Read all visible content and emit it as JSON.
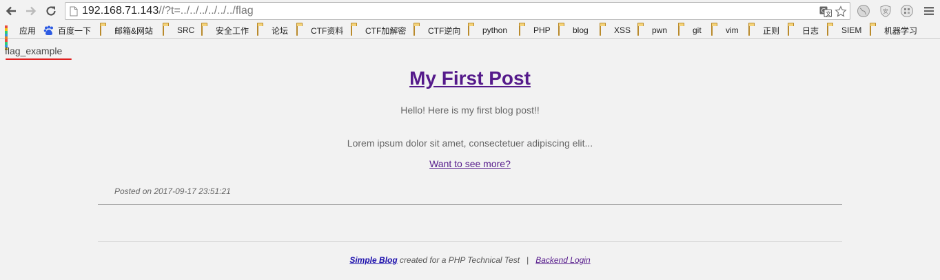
{
  "browser": {
    "url_host": "192.168.71.143",
    "url_path": "//?t=../../../../../../flag",
    "bookmarks": [
      {
        "label": "应用",
        "icon": "apps-icon"
      },
      {
        "label": "百度一下",
        "icon": "baidu-icon"
      },
      {
        "label": "邮箱&网站",
        "icon": "folder-icon"
      },
      {
        "label": "SRC",
        "icon": "folder-icon"
      },
      {
        "label": "安全工作",
        "icon": "folder-icon"
      },
      {
        "label": "论坛",
        "icon": "folder-icon"
      },
      {
        "label": "CTF资料",
        "icon": "folder-icon"
      },
      {
        "label": "CTF加解密",
        "icon": "folder-icon"
      },
      {
        "label": "CTF逆向",
        "icon": "folder-icon"
      },
      {
        "label": "python",
        "icon": "folder-icon"
      },
      {
        "label": "PHP",
        "icon": "folder-icon"
      },
      {
        "label": "blog",
        "icon": "folder-icon"
      },
      {
        "label": "XSS",
        "icon": "folder-icon"
      },
      {
        "label": "pwn",
        "icon": "folder-icon"
      },
      {
        "label": "git",
        "icon": "folder-icon"
      },
      {
        "label": "vim",
        "icon": "folder-icon"
      },
      {
        "label": "正则",
        "icon": "folder-icon"
      },
      {
        "label": "日志",
        "icon": "folder-icon"
      },
      {
        "label": "SIEM",
        "icon": "folder-icon"
      },
      {
        "label": "机器学习",
        "icon": "folder-icon"
      }
    ]
  },
  "page": {
    "flag_output": "flag_example",
    "post_title": "My First Post",
    "intro": "Hello! Here is my first blog post!!",
    "body": "Lorem ipsum dolor sit amet, consectetuer adipiscing elit...",
    "more_link": "Want to see more?",
    "posted_on": "Posted on 2017-09-17 23:51:21"
  },
  "footer": {
    "brand": "Simple Blog",
    "tagline": " created for a PHP Technical Test",
    "separator": "|",
    "backend_login": "Backend Login"
  },
  "colors": {
    "visited_link": "#551a8b",
    "brand_link": "#1a0dab",
    "annotation_underline": "#e02020"
  }
}
